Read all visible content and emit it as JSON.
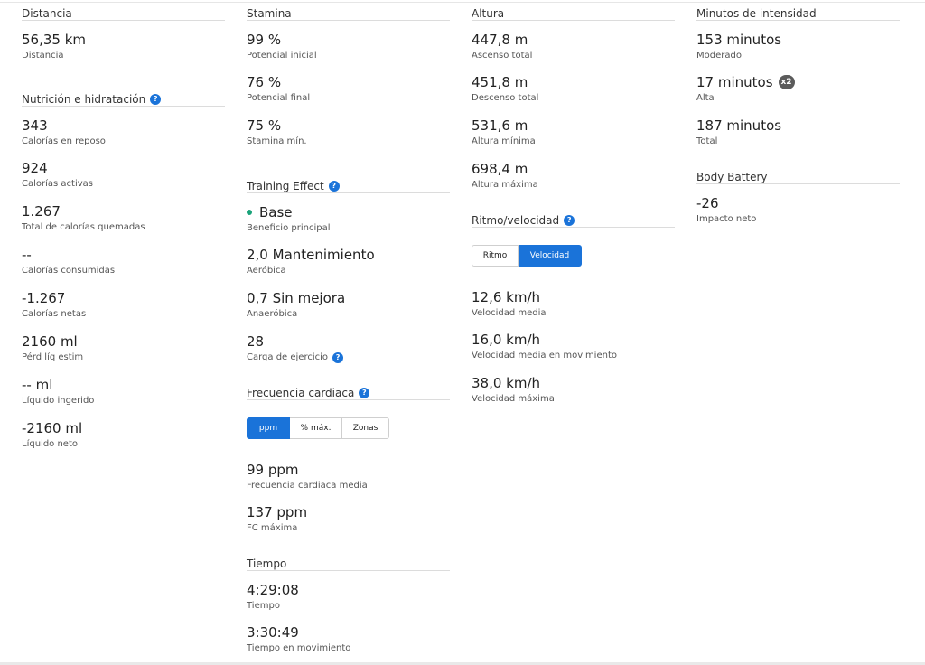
{
  "colors": {
    "accent": "#1a73d9",
    "base_dot": "#1aa37a",
    "badge": "#5b5b5b"
  },
  "distancia": {
    "header": "Distancia",
    "value": "56,35 km",
    "label": "Distancia"
  },
  "nutricion": {
    "header": "Nutrición e hidratación",
    "help_icon": "help-icon",
    "stats": [
      {
        "value": "343",
        "label": "Calorías en reposo"
      },
      {
        "value": "924",
        "label": "Calorías activas"
      },
      {
        "value": "1.267",
        "label": "Total de calorías quemadas"
      },
      {
        "value": "--",
        "label": "Calorías consumidas"
      },
      {
        "value": "-1.267",
        "label": "Calorías netas"
      },
      {
        "value": "2160 ml",
        "label": "Pérd líq estim"
      },
      {
        "value": "-- ml",
        "label": "Líquido ingerido"
      },
      {
        "value": "-2160 ml",
        "label": "Líquido neto"
      }
    ]
  },
  "stamina": {
    "header": "Stamina",
    "stats": [
      {
        "value": "99 %",
        "label": "Potencial inicial"
      },
      {
        "value": "76 %",
        "label": "Potencial final"
      },
      {
        "value": "75 %",
        "label": "Stamina mín."
      }
    ]
  },
  "training_effect": {
    "header": "Training Effect",
    "primary": {
      "value": "Base",
      "label": "Beneficio principal"
    },
    "stats": [
      {
        "value": "2,0 Mantenimiento",
        "label": "Aeróbica"
      },
      {
        "value": "0,7 Sin mejora",
        "label": "Anaeróbica"
      }
    ],
    "load": {
      "value": "28",
      "label": "Carga de ejercicio"
    }
  },
  "frecuencia": {
    "header": "Frecuencia cardiaca",
    "tabs": [
      "ppm",
      "% máx.",
      "Zonas"
    ],
    "active_tab": "ppm",
    "stats": [
      {
        "value": "99 ppm",
        "label": "Frecuencia cardiaca media"
      },
      {
        "value": "137 ppm",
        "label": "FC máxima"
      }
    ]
  },
  "tiempo": {
    "header": "Tiempo",
    "stats": [
      {
        "value": "4:29:08",
        "label": "Tiempo"
      },
      {
        "value": "3:30:49",
        "label": "Tiempo en movimiento"
      }
    ]
  },
  "altura": {
    "header": "Altura",
    "stats": [
      {
        "value": "447,8 m",
        "label": "Ascenso total"
      },
      {
        "value": "451,8 m",
        "label": "Descenso total"
      },
      {
        "value": "531,6 m",
        "label": "Altura mínima"
      },
      {
        "value": "698,4 m",
        "label": "Altura máxima"
      }
    ]
  },
  "ritmo": {
    "header": "Ritmo/velocidad",
    "tabs": [
      "Ritmo",
      "Velocidad"
    ],
    "active_tab": "Velocidad",
    "stats": [
      {
        "value": "12,6 km/h",
        "label": "Velocidad media"
      },
      {
        "value": "16,0 km/h",
        "label": "Velocidad media en movimiento"
      },
      {
        "value": "38,0 km/h",
        "label": "Velocidad máxima"
      }
    ]
  },
  "intensidad": {
    "header": "Minutos de intensidad",
    "stats": [
      {
        "value": "153 minutos",
        "label": "Moderado"
      },
      {
        "value": "17 minutos",
        "label": "Alta",
        "badge": "x2"
      },
      {
        "value": "187 minutos",
        "label": "Total"
      }
    ]
  },
  "body_battery": {
    "header": "Body Battery",
    "value": "-26",
    "label": "Impacto neto"
  }
}
